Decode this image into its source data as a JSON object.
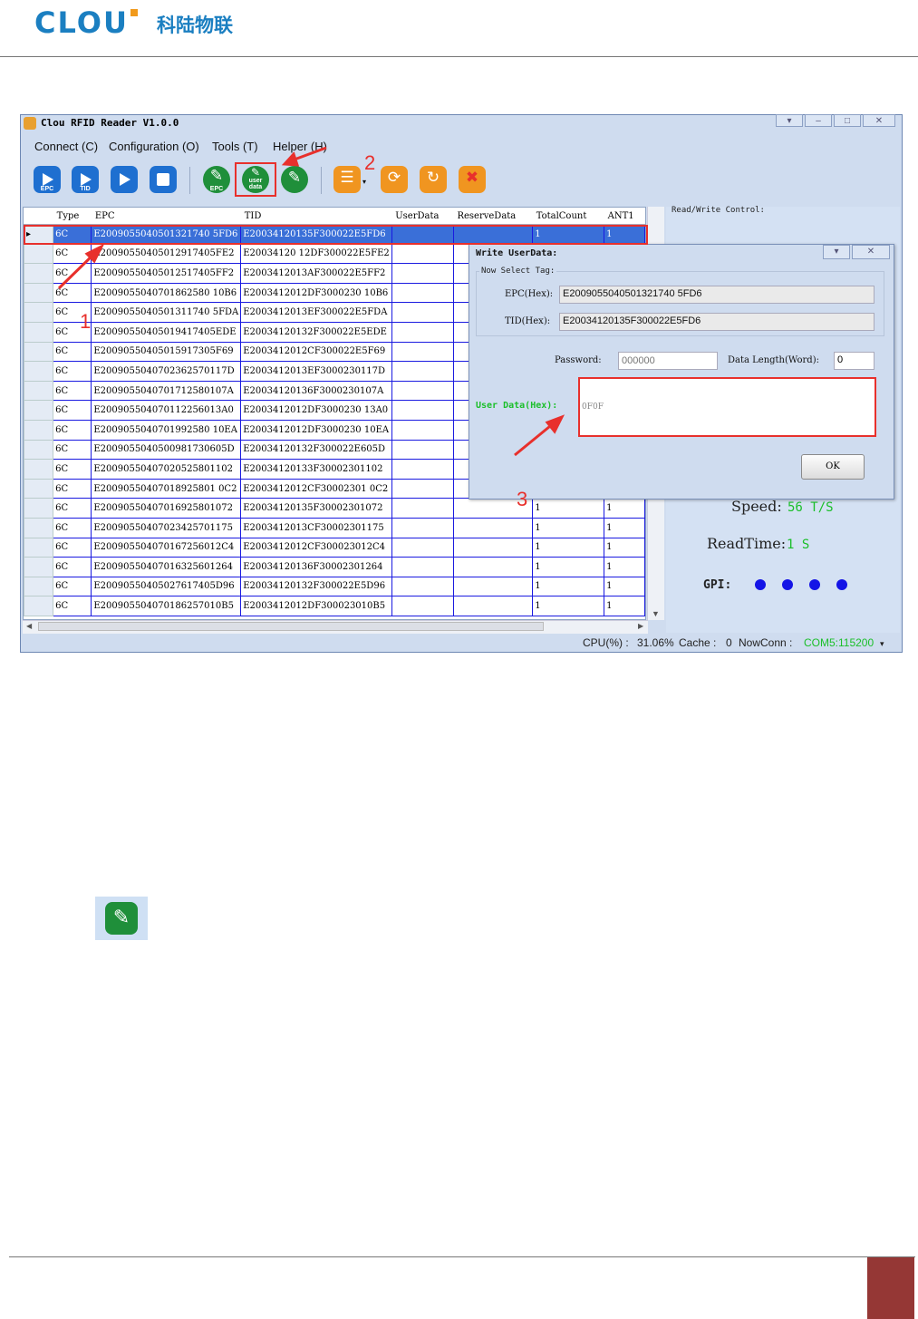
{
  "header": {
    "logo_text": "CLOU",
    "logo_cn": "科陆物联"
  },
  "window": {
    "title": "Clou RFID Reader V1.0.0"
  },
  "menu": [
    "Connect (C)",
    "Configuration (O)",
    "Tools (T)",
    "Helper (H)"
  ],
  "toolbar": {
    "items": [
      {
        "name": "read-epc-button",
        "icon": "play-epc-icon",
        "caption": "EPC"
      },
      {
        "name": "read-tid-button",
        "icon": "play-tid-icon",
        "caption": "TID"
      },
      {
        "name": "start-button",
        "icon": "play-icon",
        "caption": ""
      },
      {
        "name": "stop-button",
        "icon": "stop-icon",
        "caption": ""
      },
      {
        "name": "write-epc-button",
        "icon": "pencil-epc-icon",
        "caption": "EPC"
      },
      {
        "name": "write-userdata-button",
        "icon": "pencil-userdata-icon",
        "caption": "user data"
      },
      {
        "name": "write-button",
        "icon": "pencil-icon",
        "caption": ""
      },
      {
        "name": "list-menu-button",
        "icon": "list-icon",
        "caption": ""
      },
      {
        "name": "refresh-button",
        "icon": "refresh-icon",
        "caption": ""
      },
      {
        "name": "redo-button",
        "icon": "redo-icon",
        "caption": ""
      },
      {
        "name": "clear-button",
        "icon": "clear-icon",
        "caption": ""
      }
    ]
  },
  "grid": {
    "columns": [
      "Type",
      "EPC",
      "TID",
      "UserData",
      "ReserveData",
      "TotalCount",
      "ANT1"
    ],
    "rows": [
      [
        "6C",
        "E2009055040501321740 5FD6",
        "E20034120135F300022E5FD6",
        "",
        "",
        "1",
        "1"
      ],
      [
        "6C",
        "E20090550405012917405FE2",
        "E20034120 12DF300022E5FE2",
        "",
        "",
        "",
        ""
      ],
      [
        "6C",
        "E20090550405012517405FF2",
        "E2003412013AF300022E5FF2",
        "",
        "",
        "",
        ""
      ],
      [
        "6C",
        "E2009055040701862580 10B6",
        "E2003412012DF3000230 10B6",
        "",
        "",
        "",
        ""
      ],
      [
        "6C",
        "E2009055040501311740 5FDA",
        "E2003412013EF300022E5FDA",
        "",
        "",
        "",
        ""
      ],
      [
        "6C",
        "E20090550405019417405EDE",
        "E20034120132F300022E5EDE",
        "",
        "",
        "",
        ""
      ],
      [
        "6C",
        "E20090550405015917305F69",
        "E2003412012CF300022E5F69",
        "",
        "",
        "",
        ""
      ],
      [
        "6C",
        "E2009055040702362570117D",
        "E2003412013EF3000230117D",
        "",
        "",
        "",
        ""
      ],
      [
        "6C",
        "E2009055040701712580107A",
        "E20034120136F3000230107A",
        "",
        "",
        "",
        ""
      ],
      [
        "6C",
        "E200905504070112256013A0",
        "E2003412012DF3000230 13A0",
        "",
        "",
        "",
        ""
      ],
      [
        "6C",
        "E2009055040701992580 10EA",
        "E2003412012DF3000230 10EA",
        "",
        "",
        "",
        ""
      ],
      [
        "6C",
        "E2009055040500981730605D",
        "E20034120132F300022E605D",
        "",
        "",
        "",
        ""
      ],
      [
        "6C",
        "E20090550407020525801102",
        "E20034120133F30002301102",
        "",
        "",
        "",
        ""
      ],
      [
        "6C",
        "E20090550407018925801 0C2",
        "E2003412012CF30002301 0C2",
        "",
        "",
        "",
        ""
      ],
      [
        "6C",
        "E20090550407016925801072",
        "E20034120135F30002301072",
        "",
        "",
        "1",
        "1"
      ],
      [
        "6C",
        "E20090550407023425701175",
        "E2003412013CF30002301175",
        "",
        "",
        "1",
        "1"
      ],
      [
        "6C",
        "E200905504070167256012C4",
        "E2003412012CF300023012C4",
        "",
        "",
        "1",
        "1"
      ],
      [
        "6C",
        "E20090550407016325601264",
        "E20034120136F30002301264",
        "",
        "",
        "1",
        "1"
      ],
      [
        "6C",
        "E20090550405027617405D96",
        "E20034120132F300022E5D96",
        "",
        "",
        "1",
        "1"
      ],
      [
        "6C",
        "E200905504070186257010B5",
        "E2003412012DF300023010B5",
        "",
        "",
        "1",
        "1"
      ]
    ]
  },
  "right_panel": {
    "rw_control_label": "Read/Write Control:",
    "speed_label": "Speed:",
    "speed_value": "56 T/S",
    "readtime_label": "ReadTime:",
    "readtime_value": "1 S",
    "gpi_label": "GPI:"
  },
  "dialog": {
    "title": "Write UserData:",
    "group_label": "Now Select Tag:",
    "epc_label": "EPC(Hex):",
    "epc_value": "E2009055040501321740 5FD6",
    "tid_label": "TID(Hex):",
    "tid_value": "E20034120135F300022E5FD6",
    "password_label": "Password:",
    "password_placeholder": "000000",
    "length_label": "Data Length(Word):",
    "length_value": "0",
    "userdata_label": "User Data(Hex):",
    "userdata_value": "0F0F",
    "ok_label": "OK"
  },
  "status": {
    "cpu_label": "CPU(%) :",
    "cpu_value": "31.06%",
    "cache_label": "Cache :",
    "cache_value": "0",
    "conn_label": "NowConn :",
    "conn_value": "COM5:115200"
  },
  "annotations": [
    "1",
    "2",
    "3"
  ],
  "colors": {
    "brand": "#1b7fc1",
    "accent_red": "#e8302c",
    "green_text": "#1bbf2a",
    "page_box": "#953735"
  }
}
